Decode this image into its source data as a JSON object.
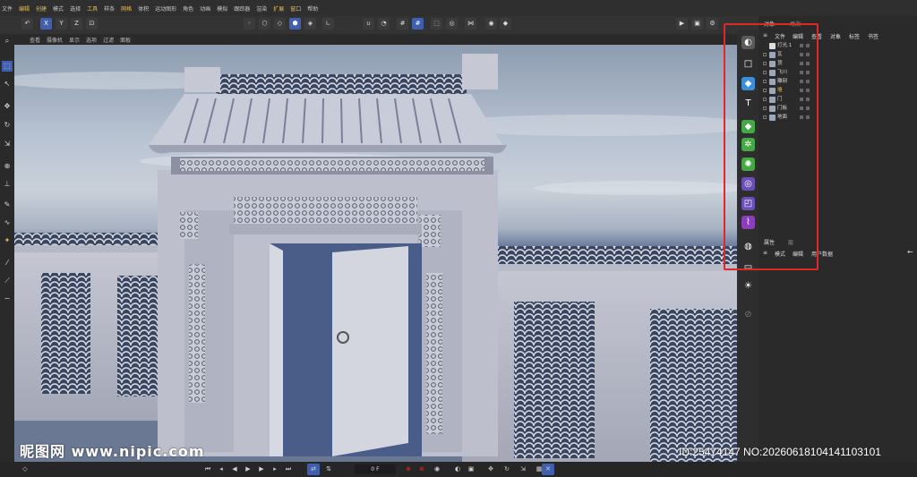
{
  "menubar": {
    "items": [
      "文件",
      "编辑",
      "创建",
      "模式",
      "选择",
      "工具",
      "样条",
      "网格",
      "体积",
      "运动图形",
      "角色",
      "动画",
      "模拟",
      "跟踪器",
      "渲染",
      "扩展",
      "窗口",
      "帮助"
    ],
    "highlighted": [
      "编辑",
      "创建",
      "工具",
      "网格",
      "扩展",
      "窗口"
    ]
  },
  "toolbar": {
    "axis_x": "X",
    "axis_y": "Y",
    "axis_z": "Z"
  },
  "viewport_menu": [
    "查看",
    "摄像机",
    "显示",
    "选项",
    "过滤",
    "面板"
  ],
  "object_manager": {
    "tabs": [
      "对象",
      "场次"
    ],
    "menu": [
      "文件",
      "编辑",
      "查看",
      "对象",
      "标签",
      "书签"
    ],
    "objects": [
      "灯光.1",
      "瓦",
      "顶",
      "飞川",
      "雕刻",
      "墙",
      "门",
      "门板",
      "地面"
    ],
    "selected_index": 5,
    "selected_color": "#e6b85a"
  },
  "attribute_manager": {
    "tabs": [
      "属性",
      "层"
    ],
    "menu": [
      "模式",
      "编辑",
      "用户数据"
    ]
  },
  "timeline": {
    "frame": "0 F"
  },
  "watermark": {
    "left": "昵图网 www.nipic.com",
    "right": "ID:25474147 NO:20260618104141103101"
  },
  "colors": {
    "highlight_box": "#e0272a",
    "accent_blue": "#3f5fb0"
  }
}
